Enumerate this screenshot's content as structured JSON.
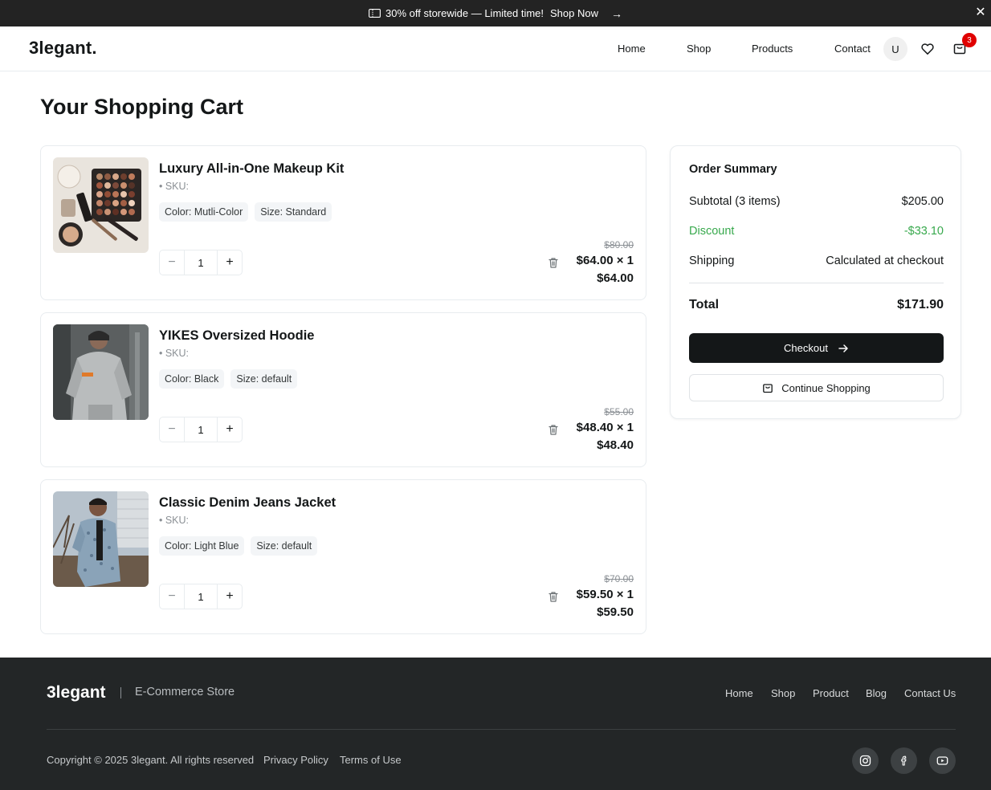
{
  "announcement": {
    "text": "30% off storewide — Limited time!",
    "cta": "Shop Now",
    "cta_arrow": "→",
    "close_glyph": "✕",
    "icon": "ticket-icon"
  },
  "header": {
    "logo": "3legant.",
    "nav": [
      "Home",
      "Shop",
      "Products",
      "Contact"
    ],
    "user_initial": "U",
    "cart_count": "3"
  },
  "page_title": "Your Shopping Cart",
  "cart_items": [
    {
      "name": "Luxury All-in-One Makeup Kit",
      "sku": "• SKU:",
      "color": "Color: Mutli-Color",
      "size": "Size: Standard",
      "qty": "1",
      "old_price": "$80.00",
      "unit_price": "$64.00 × 1",
      "total": "$64.00"
    },
    {
      "name": "YIKES Oversized Hoodie",
      "sku": "• SKU:",
      "color": "Color: Black",
      "size": "Size: default",
      "qty": "1",
      "old_price": "$55.00",
      "unit_price": "$48.40 × 1",
      "total": "$48.40"
    },
    {
      "name": "Classic Denim Jeans Jacket",
      "sku": "• SKU:",
      "color": "Color: Light Blue",
      "size": "Size: default",
      "qty": "1",
      "old_price": "$70.00",
      "unit_price": "$59.50 × 1",
      "total": "$59.50"
    }
  ],
  "qty_controls": {
    "minus": "−",
    "plus": "+"
  },
  "summary": {
    "title": "Order Summary",
    "subtotal_label": "Subtotal (3 items)",
    "subtotal_value": "$205.00",
    "discount_label": "Discount",
    "discount_value": "-$33.10",
    "shipping_label": "Shipping",
    "shipping_value": "Calculated at checkout",
    "total_label": "Total",
    "total_value": "$171.90",
    "checkout_label": "Checkout",
    "continue_label": "Continue Shopping"
  },
  "footer": {
    "logo": "3legant",
    "tagline": "E-Commerce Store",
    "links": [
      "Home",
      "Shop",
      "Product",
      "Blog",
      "Contact Us"
    ],
    "copyright": "Copyright © 2025 3legant. All rights reserved",
    "privacy": "Privacy Policy",
    "terms": "Terms of Use",
    "social": [
      "instagram-icon",
      "facebook-icon",
      "youtube-icon"
    ]
  },
  "colors": {
    "topbar_bg": "#232323",
    "footer_bg": "#232627",
    "discount_green": "#38a94d",
    "badge_red": "#e00000",
    "button_dark": "#141718"
  }
}
